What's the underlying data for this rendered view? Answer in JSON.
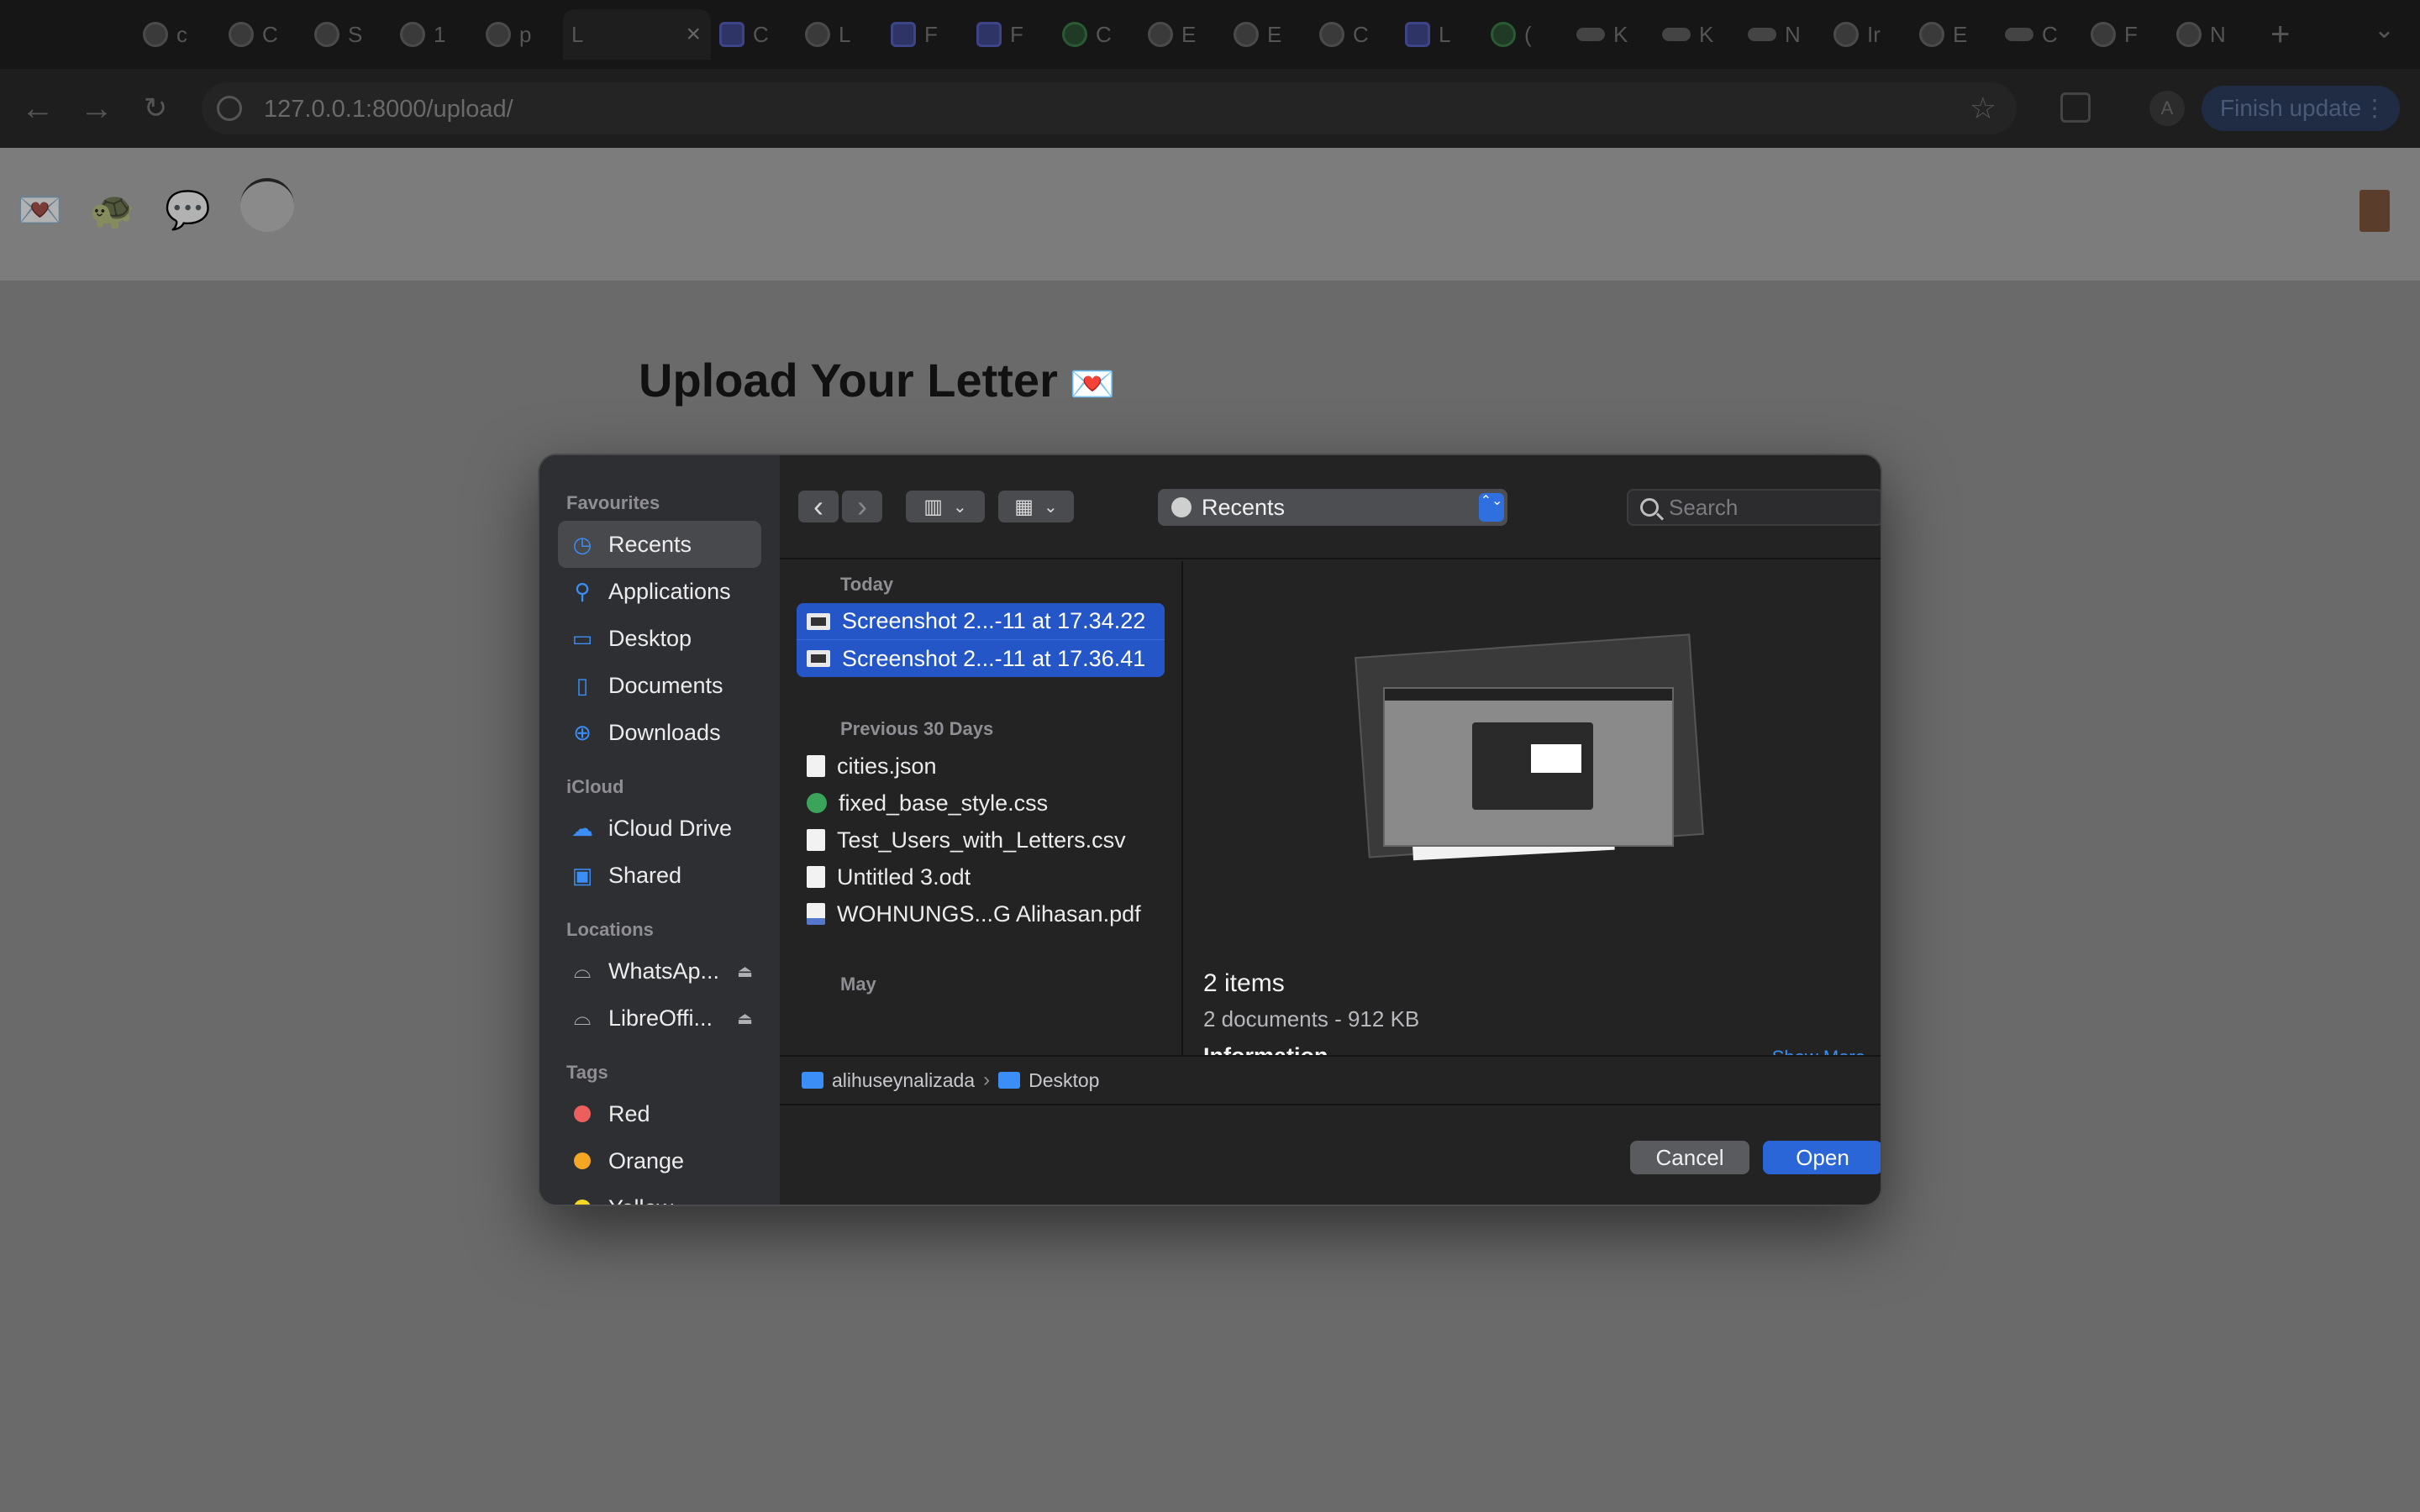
{
  "browser": {
    "tabs": [
      {
        "title": "c",
        "icon": "globe-icon"
      },
      {
        "title": "C",
        "icon": "settings-icon"
      },
      {
        "title": "S",
        "icon": "globe-icon"
      },
      {
        "title": "1",
        "icon": "globe-icon"
      },
      {
        "title": "p",
        "icon": "google-icon"
      },
      {
        "title": "L",
        "icon": "none",
        "active": true
      },
      {
        "title": "C",
        "icon": "translate-icon"
      },
      {
        "title": "L",
        "icon": "globe-icon"
      },
      {
        "title": "F",
        "icon": "s-logo-icon"
      },
      {
        "title": "F",
        "icon": "s-logo-icon"
      },
      {
        "title": "C",
        "icon": "openai-icon"
      },
      {
        "title": "E",
        "icon": "settings-icon"
      },
      {
        "title": "E",
        "icon": "globe-icon"
      },
      {
        "title": "C",
        "icon": "maps-icon"
      },
      {
        "title": "L",
        "icon": "app-icon"
      },
      {
        "title": "(",
        "icon": "whatsapp-icon"
      },
      {
        "title": "K",
        "icon": "pill-icon"
      },
      {
        "title": "K",
        "icon": "pill-icon"
      },
      {
        "title": "N",
        "icon": "pill-icon"
      },
      {
        "title": "Ir",
        "icon": "gmail-icon"
      },
      {
        "title": "E",
        "icon": "settings-icon"
      },
      {
        "title": "C",
        "icon": "pill-icon"
      },
      {
        "title": "F",
        "icon": "maps-icon"
      },
      {
        "title": "N",
        "icon": "chrome-icon"
      }
    ],
    "close_glyph": "×",
    "new_tab_glyph": "+",
    "tab_search_glyph": "⌄",
    "url": "127.0.0.1:8000/upload/",
    "profile_initial": "A",
    "finish_update_label": "Finish update",
    "menu_glyph": "⋮"
  },
  "site": {
    "header_icons": [
      "💌",
      "🐢",
      "💬"
    ],
    "title": "Upload Your Letter",
    "title_emoji": "💌"
  },
  "dialog": {
    "sidebar": {
      "favourites_label": "Favourites",
      "favourites": [
        {
          "label": "Recents",
          "icon": "clock-icon",
          "glyph": "◷",
          "selected": true
        },
        {
          "label": "Applications",
          "icon": "applications-icon",
          "glyph": "⚲"
        },
        {
          "label": "Desktop",
          "icon": "desktop-icon",
          "glyph": "▭"
        },
        {
          "label": "Documents",
          "icon": "document-icon",
          "glyph": "▯"
        },
        {
          "label": "Downloads",
          "icon": "download-icon",
          "glyph": "⊕"
        }
      ],
      "icloud_label": "iCloud",
      "icloud": [
        {
          "label": "iCloud Drive",
          "icon": "cloud-icon",
          "glyph": "☁"
        },
        {
          "label": "Shared",
          "icon": "shared-folder-icon",
          "glyph": "▣"
        }
      ],
      "locations_label": "Locations",
      "locations": [
        {
          "label": "WhatsAp...",
          "icon": "drive-icon",
          "glyph": "⌓"
        },
        {
          "label": "LibreOffi...",
          "icon": "drive-icon",
          "glyph": "⌓"
        }
      ],
      "eject_glyph": "⏏",
      "tags_label": "Tags",
      "tags": [
        {
          "label": "Red",
          "color": "#ec5f5d"
        },
        {
          "label": "Orange",
          "color": "#f5a623"
        },
        {
          "label": "Yellow",
          "color": "#f5d623"
        }
      ]
    },
    "toolbar": {
      "back_glyph": "‹",
      "forward_glyph": "›",
      "view_glyph": "▥",
      "group_glyph": "▦",
      "chevron_glyph": "⌄",
      "location": "Recents",
      "stepper_glyph": "⌃⌄",
      "search_placeholder": "Search"
    },
    "groups": [
      {
        "label": "Today",
        "files": [
          {
            "name": "Screenshot 2...-11 at 17.34.22",
            "type": "image",
            "selected": true
          },
          {
            "name": "Screenshot 2...-11 at 17.36.41",
            "type": "image",
            "selected": true
          }
        ]
      },
      {
        "label": "Previous 30 Days",
        "files": [
          {
            "name": "cities.json",
            "type": "doc"
          },
          {
            "name": "fixed_base_style.css",
            "type": "css"
          },
          {
            "name": "Test_Users_with_Letters.csv",
            "type": "doc"
          },
          {
            "name": "Untitled 3.odt",
            "type": "doc"
          },
          {
            "name": "WOHNUNGS...G Alihasan.pdf",
            "type": "pdf"
          }
        ]
      },
      {
        "label": "May",
        "files": []
      }
    ],
    "preview": {
      "count": "2 items",
      "detail": "2 documents - 912 KB",
      "info_label": "Information",
      "show_more": "Show More"
    },
    "pathbar": {
      "segments": [
        "alihuseynalizada",
        "Desktop"
      ],
      "separator": "›"
    },
    "buttons": {
      "cancel": "Cancel",
      "open": "Open"
    }
  }
}
